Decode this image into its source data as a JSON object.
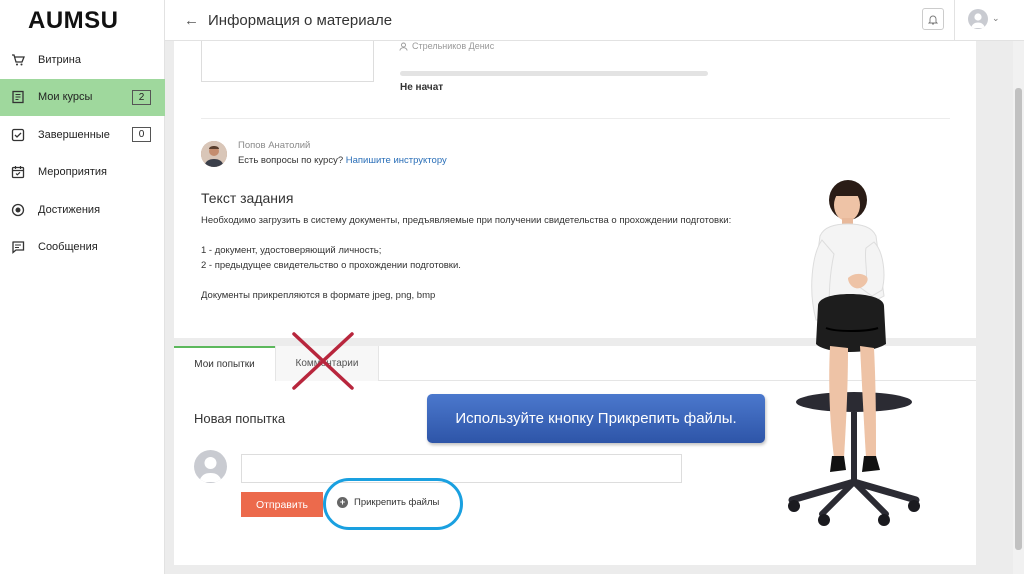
{
  "app": {
    "logo": "AUMSU"
  },
  "header": {
    "title": "Информация о материале",
    "back_icon": "arrow-left-icon"
  },
  "sidebar": {
    "items": [
      {
        "label": "Витрина",
        "icon": "cart-icon",
        "badge": null,
        "active": false
      },
      {
        "label": "Мои курсы",
        "icon": "course-book-icon",
        "badge": "2",
        "active": true
      },
      {
        "label": "Завершенные",
        "icon": "checkbox-icon",
        "badge": "0",
        "active": false
      },
      {
        "label": "Мероприятия",
        "icon": "calendar-icon",
        "badge": null,
        "active": false
      },
      {
        "label": "Достижения",
        "icon": "medal-icon",
        "badge": null,
        "active": false
      },
      {
        "label": "Сообщения",
        "icon": "message-icon",
        "badge": null,
        "active": false
      }
    ]
  },
  "material": {
    "instructor": "Стрельников Денис",
    "progress_fraction": 0,
    "status": "Не начат"
  },
  "teacher": {
    "name": "Попов Анатолий",
    "question": "Есть вопросы по курсу?",
    "link": "Напишите инструктору"
  },
  "task": {
    "title": "Текст задания",
    "lines": [
      "Необходимо загрузить в систему документы, предъявляемые при получении свидетельства о прохождении подготовки:",
      "",
      "1 - документ, удостоверяющий личность;",
      "2 - предыдущее свидетельство о прохождении подготовки.",
      "",
      "Документы прикрепляются в формате jpeg, png, bmp"
    ]
  },
  "tabs": [
    {
      "label": "Мои попытки",
      "active": true
    },
    {
      "label": "Комментарии",
      "active": false
    }
  ],
  "attempt": {
    "title": "Новая попытка",
    "input_value": "",
    "send_label": "Отправить",
    "attach_label": "Прикрепить файлы"
  },
  "callout": {
    "text": "Используйте кнопку  Прикрепить файлы."
  },
  "colors": {
    "active_nav": "#9fd89d",
    "send_button": "#ec6a4c",
    "link": "#2a6fb8",
    "callout": "#3a63b8",
    "highlight": "#1aa0e0",
    "cross": "#b8263d"
  }
}
